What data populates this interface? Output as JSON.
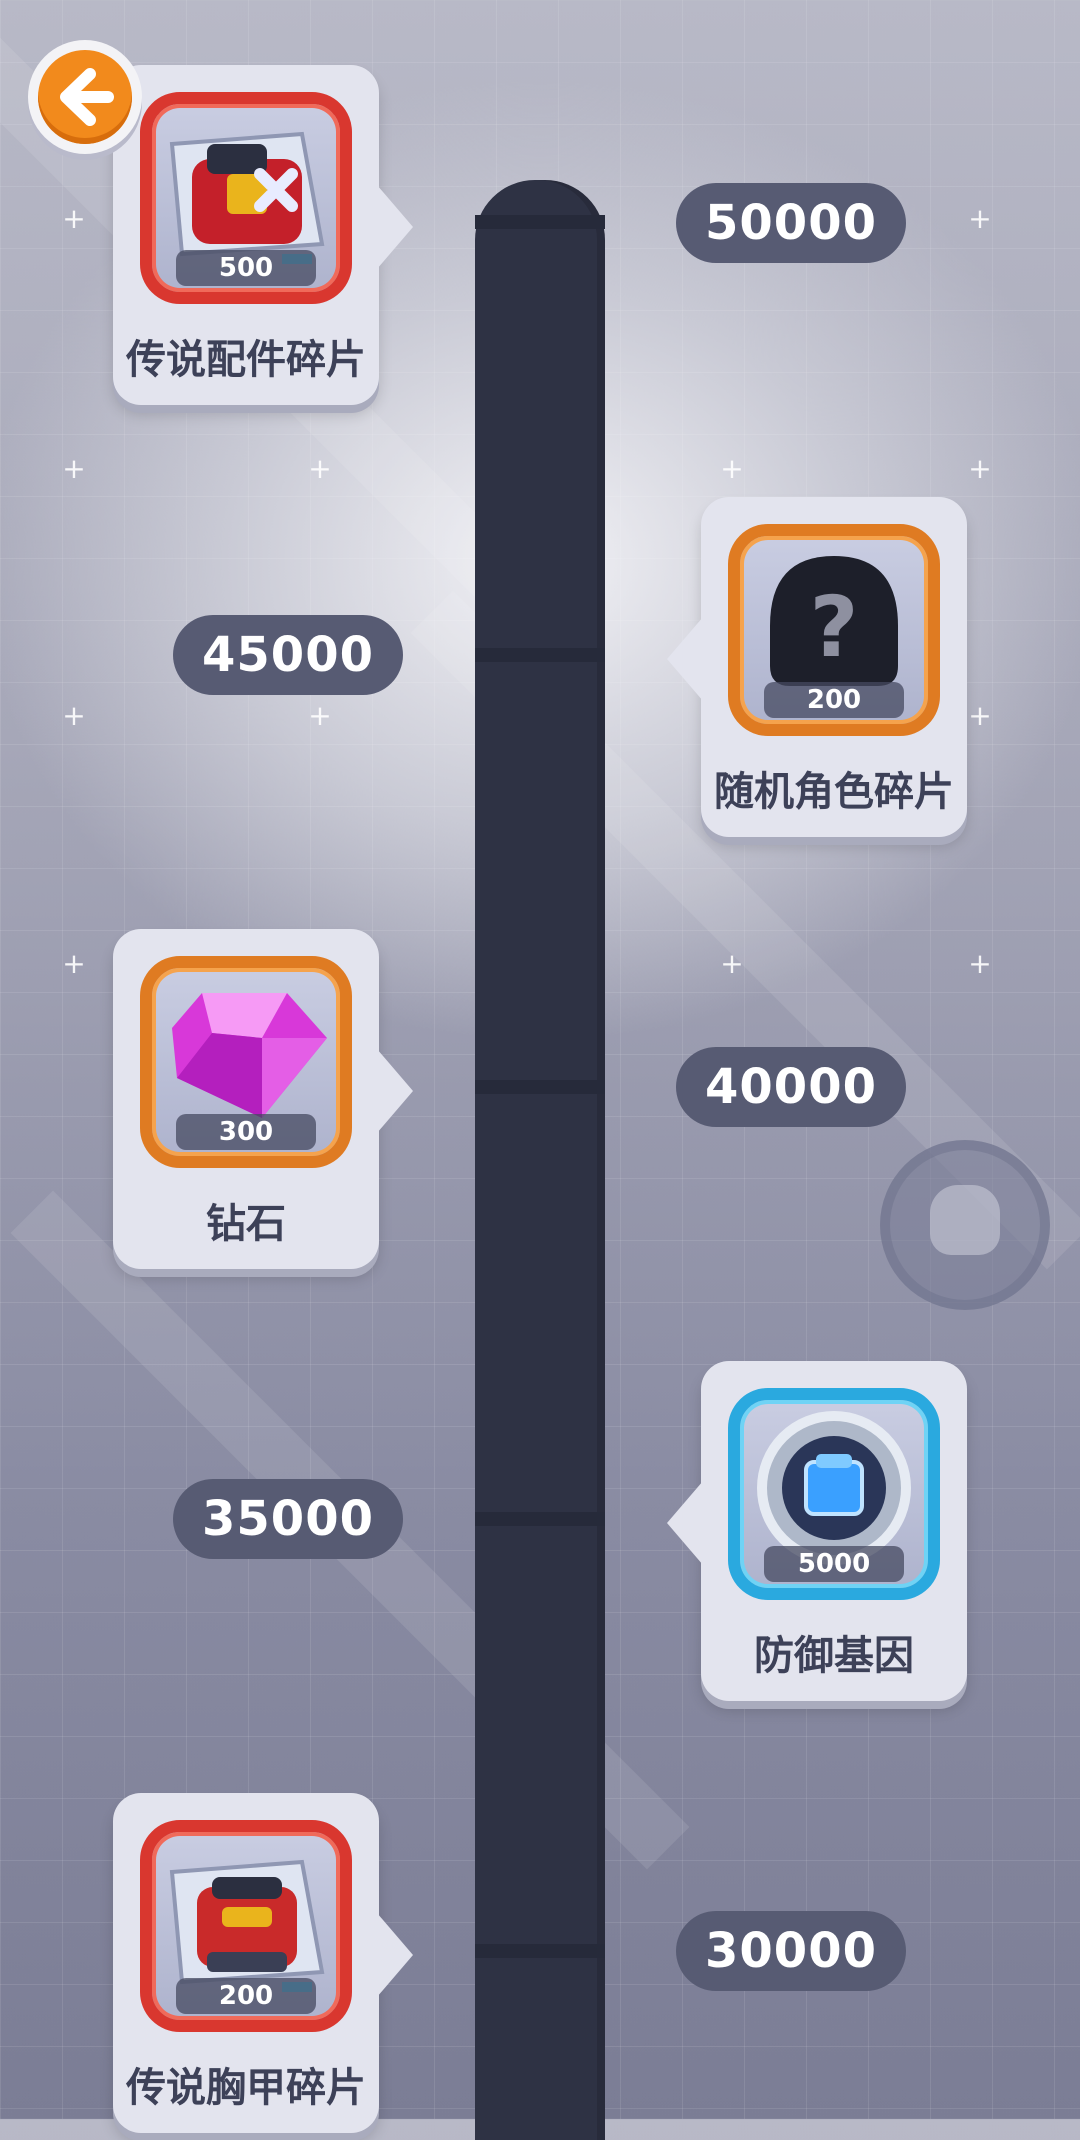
{
  "milestones": [
    {
      "score": "50000",
      "reward_label": "传说配件碎片",
      "reward_qty": "500",
      "frame": "red",
      "icon": "legendary-accessory-shard-icon"
    },
    {
      "score": "45000",
      "reward_label": "随机角色碎片",
      "reward_qty": "200",
      "frame": "orange",
      "icon": "random-character-shard-icon"
    },
    {
      "score": "40000",
      "reward_label": "钻石",
      "reward_qty": "300",
      "frame": "orange",
      "icon": "diamond-icon"
    },
    {
      "score": "35000",
      "reward_label": "防御基因",
      "reward_qty": "5000",
      "frame": "blue",
      "icon": "defense-gene-icon"
    },
    {
      "score": "30000",
      "reward_label": "传说胸甲碎片",
      "reward_qty": "200",
      "frame": "red",
      "icon": "legendary-chestplate-shard-icon"
    }
  ],
  "colors": {
    "track": "#2e3244",
    "pill": "#575b73",
    "back_button": "#f28a1c",
    "frame_red": "#d9372f",
    "frame_orange": "#df7b22",
    "frame_blue": "#2aa9df"
  },
  "back_button": {
    "icon": "arrow-left-icon"
  }
}
